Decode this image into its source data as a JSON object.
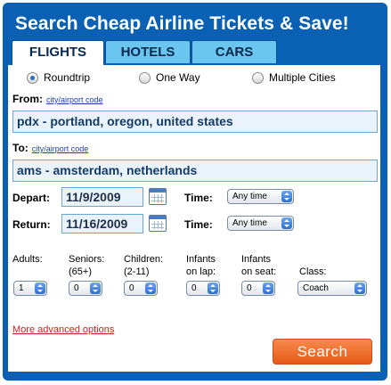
{
  "header": {
    "title": "Search Cheap Airline Tickets & Save!"
  },
  "tabs": [
    {
      "label": "FLIGHTS",
      "active": true
    },
    {
      "label": "HOTELS",
      "active": false
    },
    {
      "label": "CARS",
      "active": false
    }
  ],
  "trip_type": {
    "options": [
      "Roundtrip",
      "One Way",
      "Multiple Cities"
    ],
    "selected": "Roundtrip"
  },
  "from": {
    "label": "From:",
    "link": "city/airport code",
    "value": "pdx - portland, oregon, united states"
  },
  "to": {
    "label": "To:",
    "link": "city/airport code",
    "value": "ams - amsterdam, netherlands"
  },
  "depart": {
    "label": "Depart:",
    "date": "11/9/2009",
    "time_label": "Time:",
    "time": "Any time"
  },
  "return": {
    "label": "Return:",
    "date": "11/16/2009",
    "time_label": "Time:",
    "time": "Any time"
  },
  "passengers": {
    "adults": {
      "label": "Adults:",
      "value": "1"
    },
    "seniors": {
      "label_line1": "Seniors:",
      "label_line2": "(65+)",
      "value": "0"
    },
    "children": {
      "label_line1": "Children:",
      "label_line2": "(2-11)",
      "value": "0"
    },
    "infants_lap": {
      "label_line1": "Infants",
      "label_line2": "on lap:",
      "value": "0"
    },
    "infants_seat": {
      "label_line1": "Infants",
      "label_line2": "on seat:",
      "value": "0"
    },
    "class": {
      "label": "Class:",
      "value": "Coach"
    }
  },
  "advanced_link": "More advanced options",
  "search_button": "Search",
  "colors": {
    "frame": "#0a61b3",
    "tab_inactive": "#6ac6ee",
    "search_button": "#f27131",
    "advanced_link": "#cc1f1f"
  }
}
